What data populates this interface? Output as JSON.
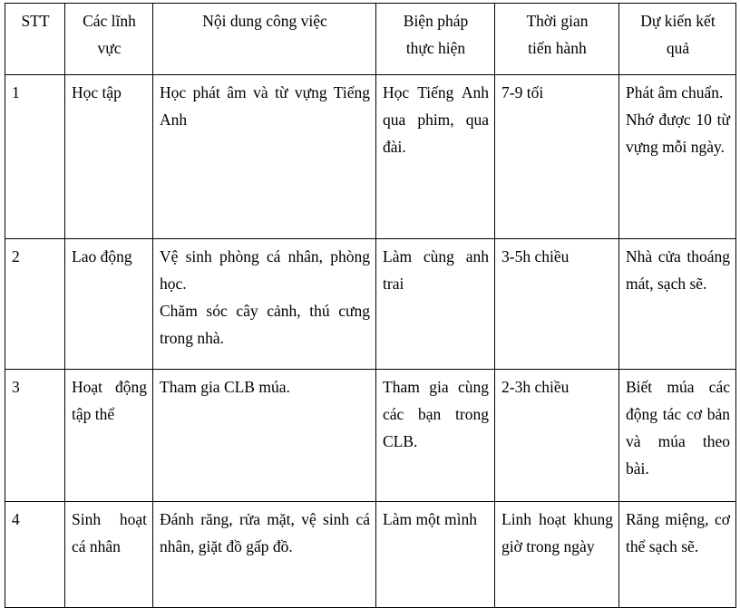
{
  "document": {
    "type": "table",
    "language": "vi",
    "background_color": "#ffffff",
    "text_color": "#000000",
    "border_color": "#000000"
  },
  "table": {
    "columns": [
      {
        "key": "stt",
        "header_lines": [
          "STT"
        ]
      },
      {
        "key": "field",
        "header_lines": [
          "Các lĩnh",
          "vực"
        ]
      },
      {
        "key": "content",
        "header_lines": [
          "Nội dung công việc"
        ]
      },
      {
        "key": "method",
        "header_lines": [
          "Biện pháp",
          "thực hiện"
        ]
      },
      {
        "key": "time",
        "header_lines": [
          "Thời gian",
          "tiến hành"
        ]
      },
      {
        "key": "result",
        "header_lines": [
          "Dự kiến kết",
          "quả"
        ]
      }
    ],
    "rows": [
      {
        "stt": "1",
        "field": "Học tập",
        "content": [
          "Học phát âm và từ vựng Tiếng Anh"
        ],
        "method": [
          "Học Tiếng Anh qua phim, qua đài."
        ],
        "time": [
          "7-9 tối"
        ],
        "result": [
          "Phát âm chuẩn.",
          "Nhớ được 10 từ vựng mỗi ngày."
        ]
      },
      {
        "stt": "2",
        "field": "Lao động",
        "content": [
          "Vệ sinh phòng cá nhân, phòng học.",
          "Chăm sóc cây cảnh, thú cưng trong nhà."
        ],
        "method": [
          "Làm cùng anh trai"
        ],
        "time": [
          "3-5h chiều"
        ],
        "result": [
          "Nhà cửa thoáng mát, sạch sẽ."
        ]
      },
      {
        "stt": "3",
        "field": "Hoạt động tập thể",
        "content": [
          "Tham gia CLB múa."
        ],
        "method": [
          "Tham gia cùng các bạn trong CLB."
        ],
        "time": [
          "2-3h chiều"
        ],
        "result": [
          "Biết múa các động tác cơ bản và múa theo bài."
        ]
      },
      {
        "stt": "4",
        "field": "Sinh hoạt cá nhân",
        "content": [
          "Đánh răng, rửa mặt, vệ sinh cá nhân, giặt đồ gấp đồ."
        ],
        "method": [
          "Làm một mình"
        ],
        "time": [
          "Linh hoạt khung giờ trong ngày"
        ],
        "result": [
          "Răng miệng, cơ thể sạch sẽ."
        ]
      }
    ]
  }
}
